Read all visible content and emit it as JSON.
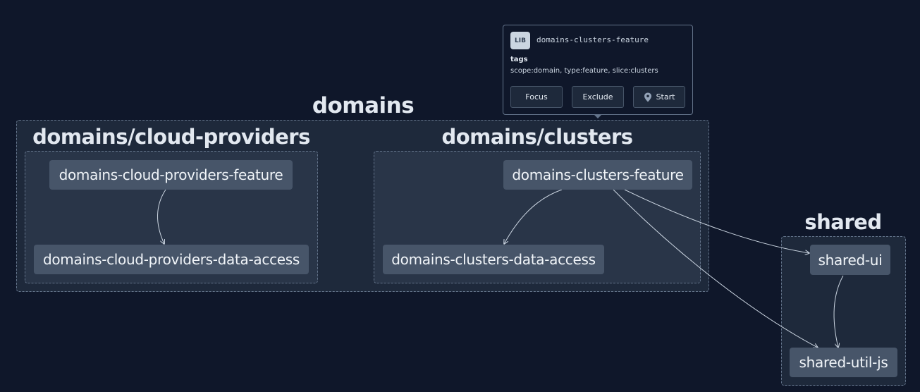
{
  "groups": {
    "domains": {
      "title": "domains"
    },
    "cloud_providers": {
      "title": "domains/cloud-providers"
    },
    "clusters": {
      "title": "domains/clusters"
    },
    "shared": {
      "title": "shared"
    }
  },
  "nodes": {
    "cloud_providers_feature": "domains-cloud-providers-feature",
    "cloud_providers_data_access": "domains-cloud-providers-data-access",
    "clusters_feature": "domains-clusters-feature",
    "clusters_data_access": "domains-clusters-data-access",
    "shared_ui": "shared-ui",
    "shared_util_js": "shared-util-js"
  },
  "edges": [
    {
      "from": "domains-cloud-providers-feature",
      "to": "domains-cloud-providers-data-access"
    },
    {
      "from": "domains-clusters-feature",
      "to": "domains-clusters-data-access"
    },
    {
      "from": "domains-clusters-feature",
      "to": "shared-ui"
    },
    {
      "from": "domains-clusters-feature",
      "to": "shared-util-js"
    },
    {
      "from": "shared-ui",
      "to": "shared-util-js"
    }
  ],
  "tooltip": {
    "badge": "LIB",
    "name": "domains-clusters-feature",
    "tags_label": "tags",
    "tags_value": "scope:domain, type:feature, slice:clusters",
    "buttons": {
      "focus": "Focus",
      "exclude": "Exclude",
      "start": "Start"
    }
  },
  "colors": {
    "background": "#0f172a",
    "group_outer": "#1e293b",
    "group_inner": "#293548",
    "node": "#475569",
    "edge": "#cbd5e1",
    "text": "#f1f5f9"
  }
}
